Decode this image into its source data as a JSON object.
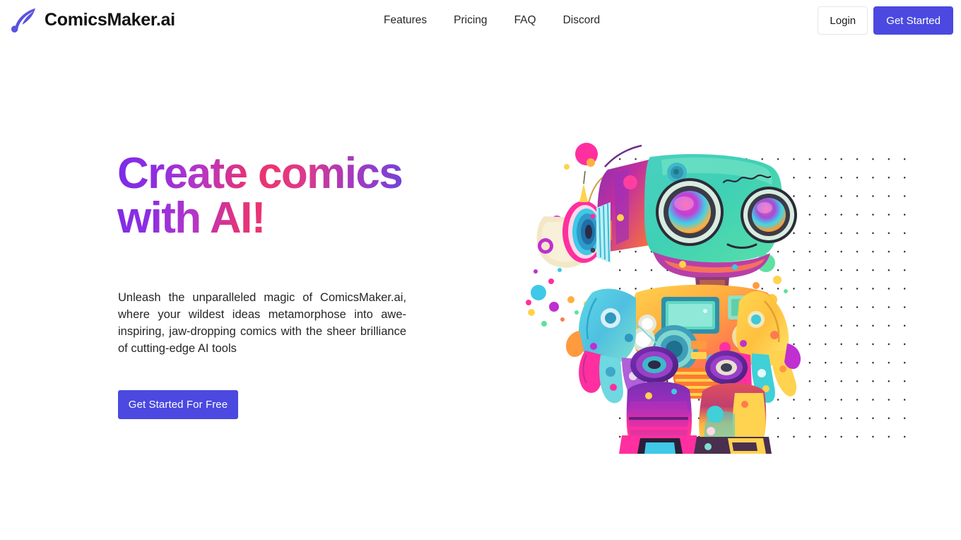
{
  "brand": {
    "name": "ComicsMaker.ai",
    "logo_icon": "feather-quill-icon",
    "logo_color": "#5b52e0"
  },
  "nav": {
    "items": [
      {
        "label": "Features",
        "name": "nav-link-features"
      },
      {
        "label": "Pricing",
        "name": "nav-link-pricing"
      },
      {
        "label": "FAQ",
        "name": "nav-link-faq"
      },
      {
        "label": "Discord",
        "name": "nav-link-discord"
      }
    ]
  },
  "header_actions": {
    "login_label": "Login",
    "get_started_label": "Get Started",
    "primary_color": "#4b49e0",
    "login_border_color": "#e6e6e9"
  },
  "hero": {
    "title_line_1": "Create comics",
    "title_line_2": "with AI!",
    "title_full": "Create comics with AI!",
    "title_gradient_start": "#7b2ce8",
    "title_gradient_mid": "#ec3570",
    "title_gradient_end": "#3a5fe6",
    "paragraph": "Unleash the unparalleled magic of ComicsMaker.ai, where your wildest ideas metamorphose into awe-inspiring, jaw-dropping comics with the sheer brilliance of cutting-edge AI tools",
    "cta_label": "Get Started For Free",
    "cta_color": "#4b49e0"
  },
  "illustration": {
    "name": "colorful-ai-robot-illustration",
    "description": "Vibrant multicolored cartoon robot mascot with large round camera-lens eyes, headphones, mechanical arms and boots, surrounded by colorful paint splatter bubbles",
    "dot_grid_color": "#2b2b2f",
    "dot_grid_spacing_px": 22
  }
}
